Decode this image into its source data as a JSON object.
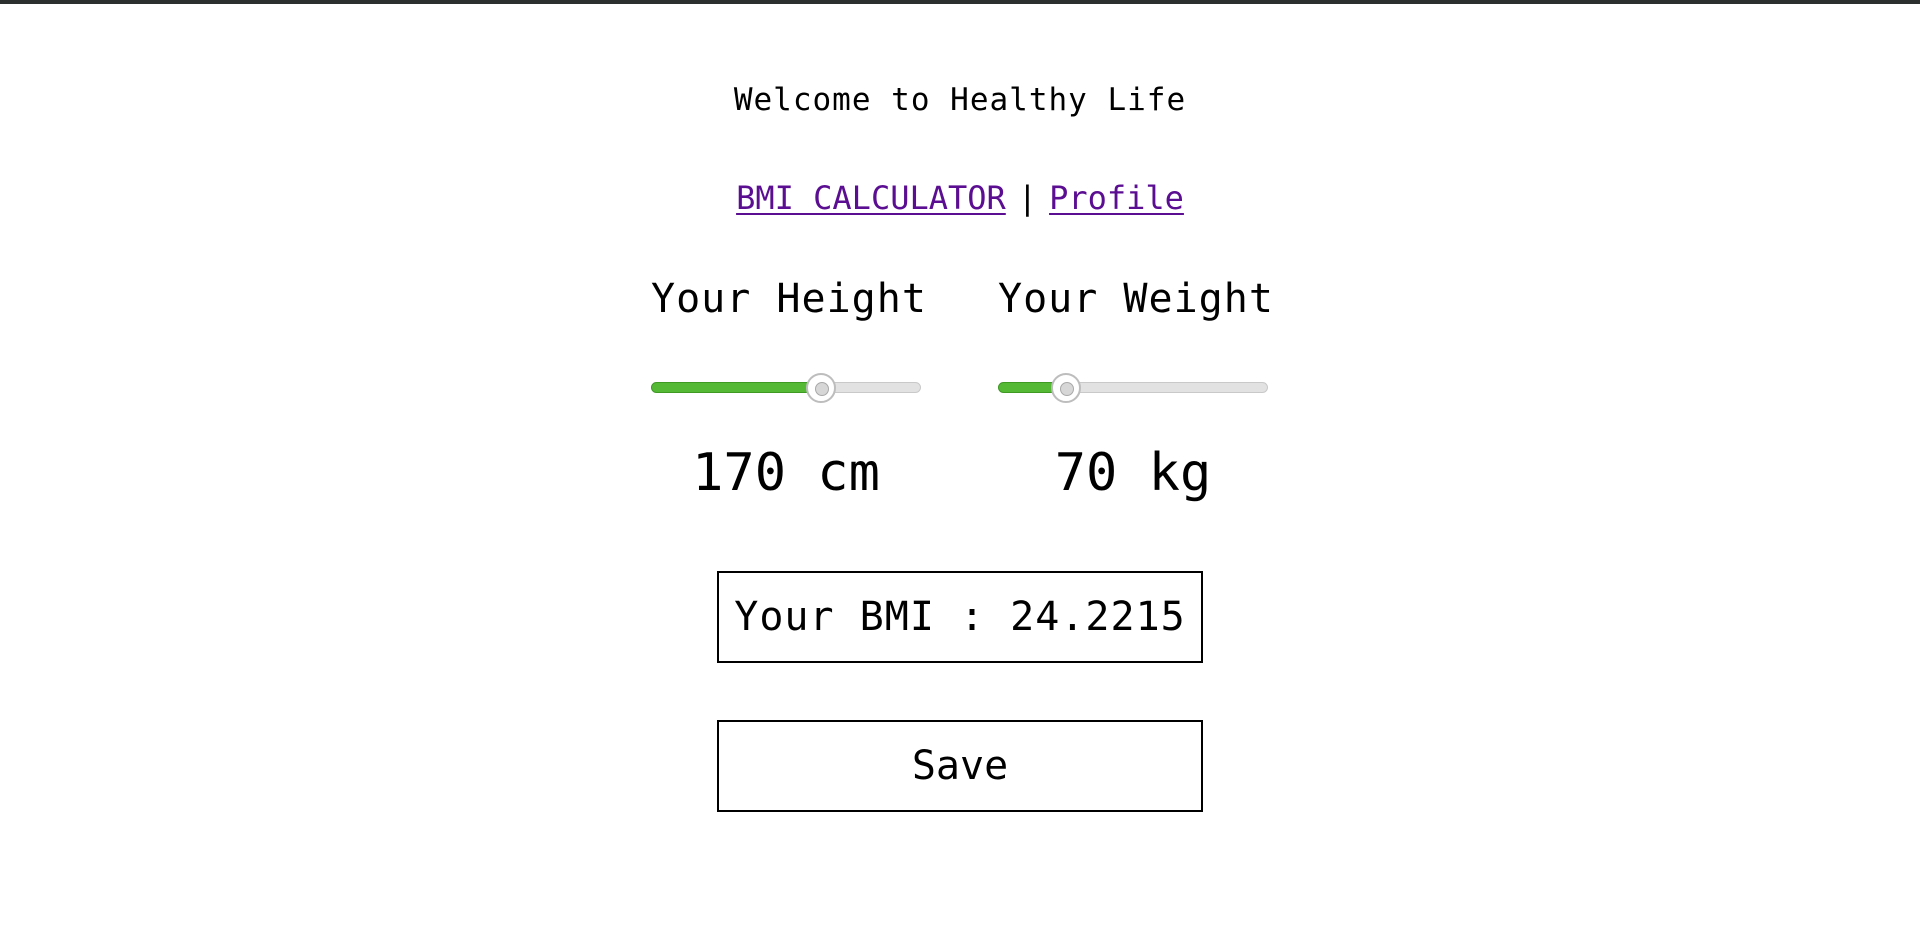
{
  "header": {
    "welcome_text": "Welcome to Healthy Life"
  },
  "nav": {
    "bmi_calculator_label": "BMI CALCULATOR",
    "separator": "|",
    "profile_label": "Profile",
    "link_color": "#5b0e91"
  },
  "height": {
    "label": "Your Height",
    "value_text": "170 cm",
    "slider_level": 0.63
  },
  "weight": {
    "label": "Your Weight",
    "value_text": "70 kg",
    "slider_level": 0.25
  },
  "result": {
    "bmi_text": "Your BMI : 24.2215"
  },
  "actions": {
    "save_label": "Save"
  },
  "colors": {
    "slider_fill": "#55b935",
    "slider_track": "#e2e2e2",
    "top_bar": "#2b2f2e"
  }
}
